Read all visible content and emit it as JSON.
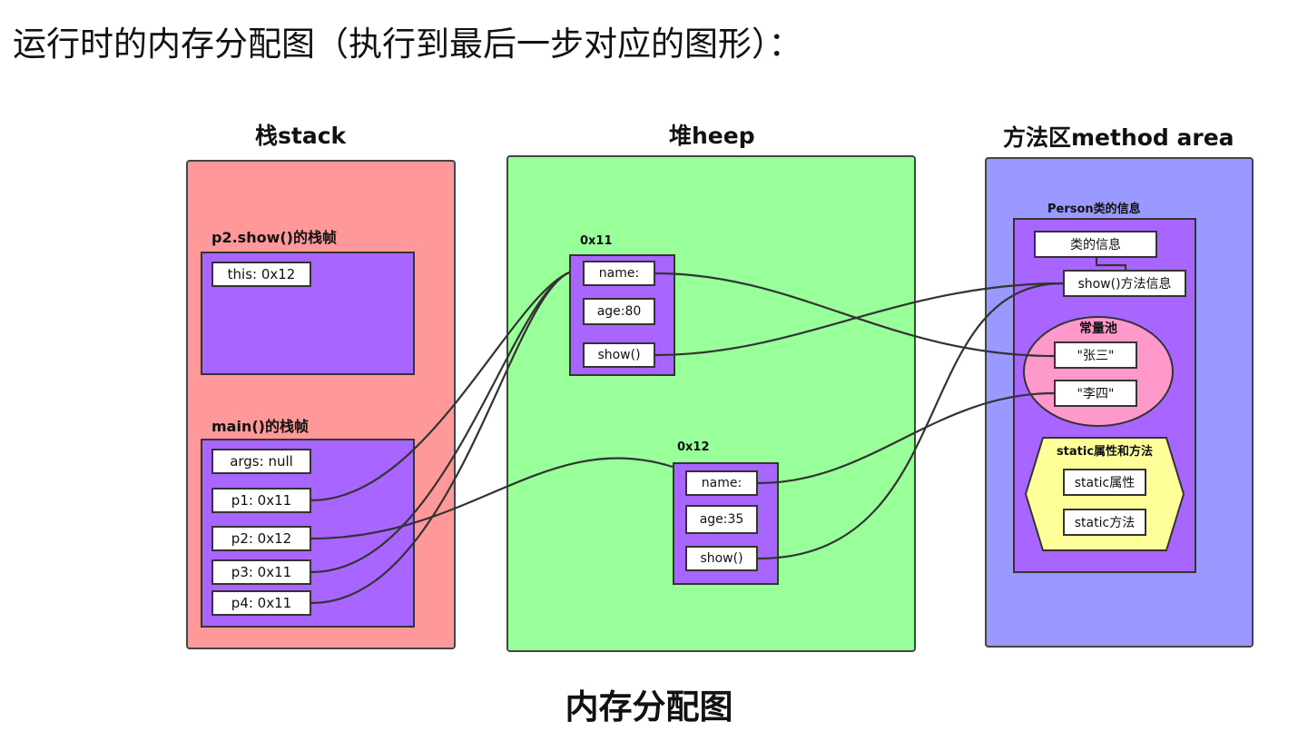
{
  "heading": "运行时的内存分配图（执行到最后一步对应的图形）：",
  "footer": "内存分配图",
  "stack": {
    "title": "栈stack",
    "frames": [
      {
        "label": "p2.show()的栈帧",
        "cells": [
          "this:  0x12"
        ]
      },
      {
        "label": "main()的栈帧",
        "cells": [
          "args: null",
          "p1:  0x11",
          "p2:  0x12",
          "p3: 0x11",
          "p4: 0x11"
        ]
      }
    ]
  },
  "heap": {
    "title": "堆heep",
    "objects": [
      {
        "address": "0x11",
        "fields": [
          "name:",
          "age:80",
          "show()"
        ]
      },
      {
        "address": "0x12",
        "fields": [
          "name:",
          "age:35",
          "show()"
        ]
      }
    ]
  },
  "method_area": {
    "title": "方法区method area",
    "class_label": "Person类的信息",
    "class_info": "类的信息",
    "method_info": "show()方法信息",
    "constant_pool": {
      "label": "常量池",
      "items": [
        "\"张三\"",
        "\"李四\""
      ]
    },
    "static_group": {
      "label": "static属性和方法",
      "items": [
        "static属性",
        "static方法"
      ]
    }
  },
  "colors": {
    "stack": "#ff9999",
    "heap": "#99ff99",
    "method_area": "#9999ff",
    "frame": "#a865ff",
    "constant_pool": "#ff99cc",
    "static_group": "#ffff99"
  }
}
